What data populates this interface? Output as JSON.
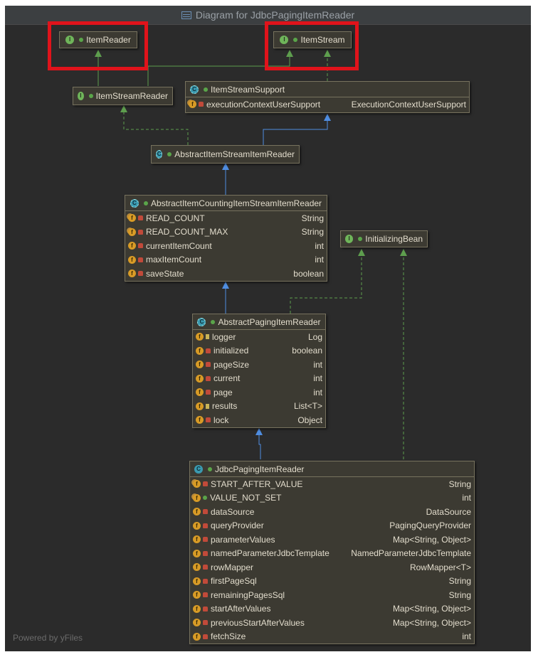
{
  "window": {
    "title": "Diagram for JdbcPagingItemReader",
    "icon": "diagram-icon"
  },
  "footer": "Powered by yFiles",
  "colors": {
    "canvas": "#2b2b2b",
    "node": "#3c3a32",
    "inherit_edge": "#4f8de0",
    "impl_edge": "#5e9e4e",
    "highlight": "#e0131b"
  },
  "nodes": {
    "item_reader": {
      "name": "ItemReader",
      "kind": "I"
    },
    "item_stream": {
      "name": "ItemStream",
      "kind": "I"
    },
    "item_stream_reader": {
      "name": "ItemStreamReader",
      "kind": "I"
    },
    "item_stream_support": {
      "name": "ItemStreamSupport",
      "kind": "A",
      "fields": [
        {
          "vis": "private",
          "static": true,
          "name": "executionContextUserSupport",
          "type": "ExecutionContextUserSupport"
        }
      ]
    },
    "abstract_item_stream_item_reader": {
      "name": "AbstractItemStreamItemReader",
      "kind": "A"
    },
    "initializing_bean": {
      "name": "InitializingBean",
      "kind": "I"
    },
    "abstract_counting": {
      "name": "AbstractItemCountingItemStreamItemReader",
      "kind": "A",
      "fields": [
        {
          "vis": "private",
          "static": true,
          "name": "READ_COUNT",
          "type": "String"
        },
        {
          "vis": "private",
          "static": true,
          "name": "READ_COUNT_MAX",
          "type": "String"
        },
        {
          "vis": "private",
          "static": false,
          "name": "currentItemCount",
          "type": "int"
        },
        {
          "vis": "private",
          "static": false,
          "name": "maxItemCount",
          "type": "int"
        },
        {
          "vis": "private",
          "static": false,
          "name": "saveState",
          "type": "boolean"
        }
      ]
    },
    "abstract_paging": {
      "name": "AbstractPagingItemReader",
      "kind": "A",
      "fields": [
        {
          "vis": "protected",
          "static": false,
          "name": "logger",
          "type": "Log"
        },
        {
          "vis": "private",
          "static": false,
          "name": "initialized",
          "type": "boolean"
        },
        {
          "vis": "private",
          "static": false,
          "name": "pageSize",
          "type": "int"
        },
        {
          "vis": "private",
          "static": false,
          "name": "current",
          "type": "int"
        },
        {
          "vis": "private",
          "static": false,
          "name": "page",
          "type": "int"
        },
        {
          "vis": "protected",
          "static": false,
          "name": "results",
          "type": "List<T>"
        },
        {
          "vis": "private",
          "static": false,
          "name": "lock",
          "type": "Object"
        }
      ]
    },
    "jdbc_paging": {
      "name": "JdbcPagingItemReader",
      "kind": "C",
      "fields": [
        {
          "vis": "private",
          "static": true,
          "name": "START_AFTER_VALUE",
          "type": "String"
        },
        {
          "vis": "public",
          "static": true,
          "name": "VALUE_NOT_SET",
          "type": "int"
        },
        {
          "vis": "private",
          "static": false,
          "name": "dataSource",
          "type": "DataSource"
        },
        {
          "vis": "private",
          "static": false,
          "name": "queryProvider",
          "type": "PagingQueryProvider"
        },
        {
          "vis": "private",
          "static": false,
          "name": "parameterValues",
          "type": "Map<String, Object>"
        },
        {
          "vis": "private",
          "static": false,
          "name": "namedParameterJdbcTemplate",
          "type": "NamedParameterJdbcTemplate"
        },
        {
          "vis": "private",
          "static": false,
          "name": "rowMapper",
          "type": "RowMapper<T>"
        },
        {
          "vis": "private",
          "static": false,
          "name": "firstPageSql",
          "type": "String"
        },
        {
          "vis": "private",
          "static": false,
          "name": "remainingPagesSql",
          "type": "String"
        },
        {
          "vis": "private",
          "static": false,
          "name": "startAfterValues",
          "type": "Map<String, Object>"
        },
        {
          "vis": "private",
          "static": false,
          "name": "previousStartAfterValues",
          "type": "Map<String, Object>"
        },
        {
          "vis": "private",
          "static": false,
          "name": "fetchSize",
          "type": "int"
        }
      ]
    }
  }
}
